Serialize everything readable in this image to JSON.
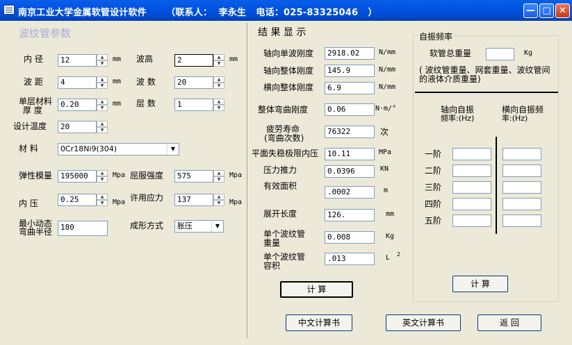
{
  "window": {
    "title": "南京工业大学金属软管设计软件      （联系人：  李永生   电话：025-83325046   ）",
    "minimize": "—",
    "maximize": "□",
    "close": "✕"
  },
  "params": {
    "section_title": "波纹管参数",
    "inner_diameter": {
      "label": "内 径",
      "value": "12",
      "unit": "mm"
    },
    "wave_height": {
      "label": "波高",
      "value": "2",
      "unit": "mm"
    },
    "wave_pitch": {
      "label": "波 距",
      "value": "4",
      "unit": "mm"
    },
    "wave_count": {
      "label": "波 数",
      "value": "20"
    },
    "layer_thickness": {
      "label1": "单层材料",
      "label2": "厚 度",
      "value": "0.20",
      "unit": "mm"
    },
    "layer_count": {
      "label": "层 数",
      "value": "1"
    },
    "design_temp": {
      "label": "设计温度",
      "value": "20"
    },
    "material": {
      "label": "材 料",
      "value": "0Cr18Ni9(304)"
    },
    "elastic_modulus": {
      "label": "弹性模量",
      "value": "195000",
      "unit": "Mpa"
    },
    "yield_strength": {
      "label": "屈服强度",
      "value": "575",
      "unit": "Mpa"
    },
    "inner_pressure": {
      "label": "内 压",
      "value": "0.25",
      "unit": "Mpa"
    },
    "allowable_stress": {
      "label": "许用应力",
      "value": "137",
      "unit": "Mpa"
    },
    "min_bend_radius": {
      "label1": "最小动态",
      "label2": "弯曲半径",
      "value": "180"
    },
    "forming_method": {
      "label": "成形方式",
      "value": "胀压"
    }
  },
  "results": {
    "section_title": "结 果 显 示",
    "axial_single_wave_stiffness": {
      "label": "轴向单波刚度",
      "value": "2918.02",
      "unit": "N/mm"
    },
    "axial_total_stiffness": {
      "label": "轴向整体刚度",
      "value": "145.9",
      "unit": "N/mm"
    },
    "lateral_total_stiffness": {
      "label": "横向整体刚度",
      "value": "6.9",
      "unit": "N/mm"
    },
    "total_bending_stiffness": {
      "label": "整体弯曲刚度",
      "value": "0.06",
      "unit": "N·m/°"
    },
    "fatigue_life": {
      "label1": "疲劳寿命",
      "label2": "(弯曲次数)",
      "value": "76322",
      "unit": "次"
    },
    "plane_instability_pressure": {
      "label": "平面失稳极限内压",
      "value": "10.11",
      "unit": "MPa"
    },
    "pressure_thrust": {
      "label": "压力推力",
      "value": "0.0396",
      "unit": "KN"
    },
    "effective_area": {
      "label": "有效面积",
      "value": ".0002",
      "unit": "m"
    },
    "unfolded_length": {
      "label": "展开长度",
      "value": "126.",
      "unit": "mm"
    },
    "single_weight": {
      "label1": "单个波纹管",
      "label2": "重量",
      "value": "0.008",
      "unit": "Kg"
    },
    "single_volume": {
      "label1": "单个波纹管",
      "label2": "容积",
      "value": ".013",
      "unit": "L",
      "unit_sup": "2"
    },
    "calc_button": "计 算"
  },
  "freq": {
    "group_title": "自振频率",
    "total_weight_label": "软管总重量",
    "total_weight_value": "",
    "total_weight_unit": "Kg",
    "note_line1": "( 波纹管重量、网套重量、波纹管间",
    "note_line2": "的液体介质重量)",
    "axial_header1": "轴向自振",
    "axial_header2": "频率:(Hz)",
    "lateral_header1": "横向自振频",
    "lateral_header2": "率:(Hz)",
    "orders": [
      "一阶",
      "二阶",
      "三阶",
      "四阶",
      "五阶"
    ],
    "axial_values": [
      "",
      "",
      "",
      "",
      ""
    ],
    "lateral_values": [
      "",
      "",
      "",
      "",
      ""
    ],
    "calc_button": "计 算"
  },
  "bottom": {
    "cn_report": "中文计算书",
    "en_report": "英文计算书",
    "back": "返 回"
  }
}
